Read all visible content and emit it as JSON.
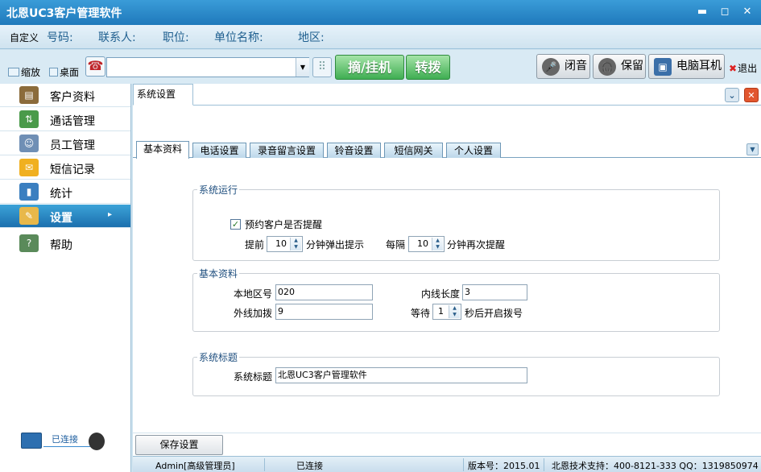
{
  "window": {
    "title": "北恩UC3客户管理软件",
    "minimize": "▬",
    "maximize": "◻",
    "close": "✕"
  },
  "info_row": {
    "custom": "自定义",
    "labels": [
      "号码:",
      "联系人:",
      "职位:",
      "单位名称:",
      "地区:"
    ]
  },
  "toolbar": {
    "zoom_label": "缩放",
    "desktop_label": "桌面",
    "dial_value": "",
    "pickup_label": "摘/挂机",
    "transfer_label": "转拨",
    "mute_label": "闭音",
    "hold_label": "保留",
    "pc_headset_label": "电脑耳机",
    "exit_label": "退出"
  },
  "sidebar": {
    "items": [
      {
        "label": "客户资料",
        "icon": "customer-icon"
      },
      {
        "label": "通话管理",
        "icon": "call-icon"
      },
      {
        "label": "员工管理",
        "icon": "staff-icon"
      },
      {
        "label": "短信记录",
        "icon": "sms-icon"
      },
      {
        "label": "统计",
        "icon": "stats-icon"
      },
      {
        "label": "设置",
        "icon": "settings-icon",
        "active": true
      },
      {
        "label": "帮助",
        "icon": "help-icon"
      }
    ],
    "connection_status": "已连接"
  },
  "main": {
    "panel_tab": "系统设置",
    "tabs": [
      "基本资料",
      "电话设置",
      "录音留言设置",
      "铃音设置",
      "短信网关",
      "个人设置"
    ],
    "active_tab": "基本资料",
    "system_run": {
      "legend": "系统运行",
      "reminder_label": "预约客户是否提醒",
      "reminder_checked": true,
      "advance_prefix": "提前",
      "advance_value": "10",
      "advance_suffix": "分钟弹出提示",
      "interval_prefix": "每隔",
      "interval_value": "10",
      "interval_suffix": "分钟再次提醒"
    },
    "basic_info": {
      "legend": "基本资料",
      "area_code_label": "本地区号",
      "area_code_value": "020",
      "ext_length_label": "内线长度",
      "ext_length_value": "3",
      "outside_prefix_label": "外线加拨",
      "outside_prefix_value": "9",
      "wait_label": "等待",
      "wait_value": "1",
      "wait_suffix": "秒后开启拨号"
    },
    "system_title": {
      "legend": "系统标题",
      "label": "系统标题",
      "value": "北恩UC3客户管理软件"
    },
    "save_label": "保存设置"
  },
  "statusbar": {
    "user": "Admin[高级管理员]",
    "connection": "已连接",
    "version": "版本号：2015.01",
    "support": "北恩技术支持：400-8121-333 QQ：1319850974"
  }
}
